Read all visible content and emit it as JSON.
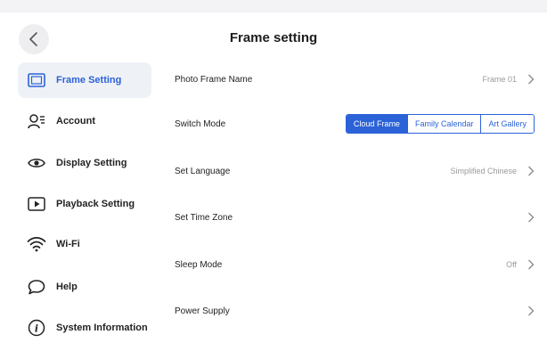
{
  "header": {
    "title": "Frame setting",
    "back_icon": "chevron-left-icon"
  },
  "sidebar": {
    "items": [
      {
        "label": "Frame Setting",
        "icon": "frame-icon",
        "active": true
      },
      {
        "label": "Account",
        "icon": "account-list-icon",
        "active": false
      },
      {
        "label": "Display Setting",
        "icon": "eye-icon",
        "active": false
      },
      {
        "label": "Playback Setting",
        "icon": "play-icon",
        "active": false
      },
      {
        "label": "Wi-Fi",
        "icon": "wifi-icon",
        "active": false
      },
      {
        "label": "Help",
        "icon": "chat-bubble-icon",
        "active": false
      },
      {
        "label": "System Information",
        "icon": "info-icon",
        "active": false
      }
    ]
  },
  "settings": {
    "photo_frame_name": {
      "label": "Photo Frame Name",
      "value": "Frame 01"
    },
    "switch_mode": {
      "label": "Switch Mode",
      "options": [
        "Cloud Frame",
        "Family Calendar",
        "Art Gallery"
      ],
      "selected": "Cloud Frame"
    },
    "set_language": {
      "label": "Set Language",
      "value": "Simplified Chinese"
    },
    "set_time_zone": {
      "label": "Set Time Zone",
      "value": ""
    },
    "sleep_mode": {
      "label": "Sleep Mode",
      "value": "Off"
    },
    "power_supply": {
      "label": "Power Supply",
      "value": ""
    }
  },
  "colors": {
    "accent": "#2c62d8",
    "active_bg": "#eef1f6",
    "muted_text": "#9a9a9a"
  }
}
